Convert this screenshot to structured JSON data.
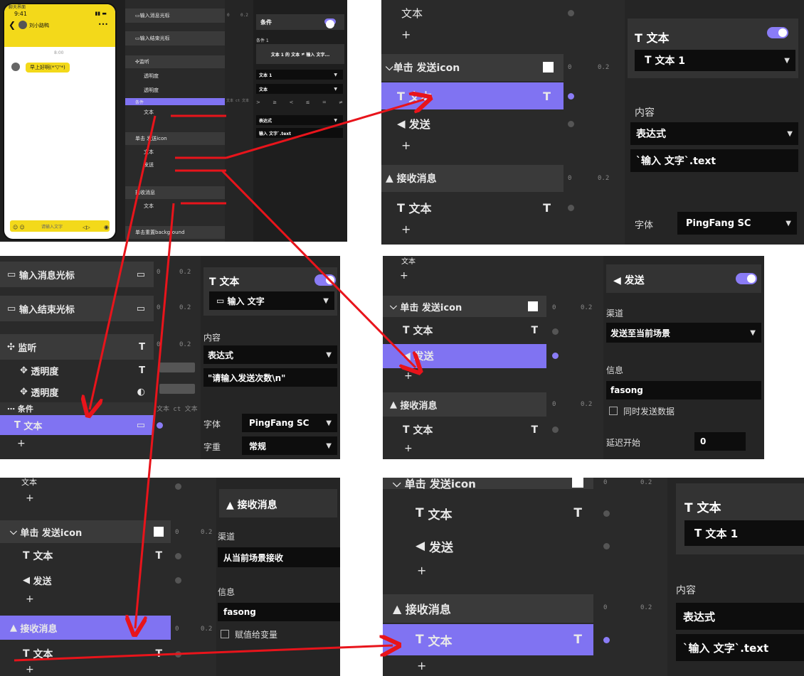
{
  "phone": {
    "window_title": "聊天界面",
    "status_time": "9:41",
    "chat_name": "刘小路鸭",
    "timestamp": "8:00",
    "message": "早上好啊(*'▽'*)",
    "input_placeholder": "请输入文字",
    "more": "•••"
  },
  "panel_overview": {
    "layers": [
      {
        "name": "输入消息光标",
        "badge": "▭"
      },
      {
        "name": "输入结束光标",
        "badge": "▭"
      },
      {
        "name": "监听",
        "badge": "T"
      },
      {
        "name": "透明度",
        "badge": "T"
      },
      {
        "name": "透明度",
        "badge": "◐"
      },
      {
        "name": "条件",
        "badge": ""
      },
      {
        "name": "文本",
        "badge": "▭"
      },
      {
        "name": "单击 发送icon",
        "badge": "■"
      },
      {
        "name": "文本",
        "badge": "T"
      },
      {
        "name": "发送",
        "badge": ""
      },
      {
        "name": "接收消息",
        "badge": ""
      },
      {
        "name": "文本",
        "badge": "T"
      },
      {
        "name": "单击重置background",
        "badge": "▮"
      }
    ],
    "timeline_ticks": [
      "0",
      "0.2"
    ],
    "timeline_note": "文本 ct 文本",
    "inspector": {
      "title": "条件",
      "section": "条件 1",
      "condition_left": "文本 1 的 文本",
      "condition_op": "≠",
      "condition_right": "输入 文字...",
      "target": "文本 1",
      "property": "文本",
      "operators": [
        ">",
        "≥",
        "<",
        "≤",
        "=",
        "≠"
      ],
      "mode": "表达式",
      "expression": "输入 文字`.text"
    }
  },
  "panel_a": {
    "rows": [
      {
        "name": "文本",
        "badge": "▭"
      },
      {
        "name": "单击 发送icon",
        "badge": ""
      },
      {
        "name": "文本",
        "badge": "T"
      },
      {
        "name": "发送",
        "badge": ""
      },
      {
        "name": "接收消息",
        "badge": ""
      },
      {
        "name": "文本",
        "badge": "T"
      }
    ],
    "ticks": [
      "0",
      "0.2"
    ],
    "inspector": {
      "title": "文本",
      "target": "文本 1",
      "content_label": "内容",
      "mode": "表达式",
      "value": "`输入 文字`.text",
      "font_label": "字体",
      "font_value": "PingFang SC"
    }
  },
  "panel_b": {
    "rows": [
      {
        "name": "输入消息光标",
        "badge": "▭"
      },
      {
        "name": "输入结束光标",
        "badge": "▭"
      },
      {
        "name": "监听",
        "badge": "T"
      },
      {
        "name": "透明度",
        "badge": "T"
      },
      {
        "name": "透明度",
        "badge": "◐"
      },
      {
        "name": "条件",
        "badge": ""
      },
      {
        "name": "文本",
        "badge": "▭"
      }
    ],
    "ticks": [
      "0",
      "0.2"
    ],
    "timeline_note": "文本 ct 文本",
    "inspector": {
      "title": "文本",
      "target": "输入 文字",
      "content_label": "内容",
      "mode": "表达式",
      "value": "\"请输入发送次数\\n\"",
      "font_label": "字体",
      "font_value": "PingFang SC",
      "weight_label": "字重",
      "weight_value": "常规"
    }
  },
  "panel_c": {
    "rows": [
      {
        "name": "文本",
        "badge": "T"
      },
      {
        "name": "单击 发送icon",
        "badge": ""
      },
      {
        "name": "文本",
        "badge": "T"
      },
      {
        "name": "发送",
        "badge": ""
      },
      {
        "name": "接收消息",
        "badge": ""
      },
      {
        "name": "文本",
        "badge": "T"
      }
    ],
    "ticks": [
      "0",
      "0.2"
    ],
    "inspector": {
      "title": "发送",
      "channel_label": "渠道",
      "channel_value": "发送至当前场景",
      "info_label": "信息",
      "info_value": "fasong",
      "check_label": "同时发送数据",
      "delay_label": "延迟开始",
      "delay_value": "0"
    }
  },
  "panel_d": {
    "rows": [
      {
        "name": "文本",
        "badge": "▭"
      },
      {
        "name": "单击 发送icon",
        "badge": ""
      },
      {
        "name": "文本",
        "badge": "T"
      },
      {
        "name": "发送",
        "badge": ""
      },
      {
        "name": "接收消息",
        "badge": ""
      },
      {
        "name": "文本",
        "badge": "T"
      }
    ],
    "ticks": [
      "0",
      "0.2"
    ],
    "inspector": {
      "title": "接收消息",
      "channel_label": "渠道",
      "channel_value": "从当前场景接收",
      "info_label": "信息",
      "info_value": "fasong",
      "check_label": "赋值给变量"
    }
  },
  "panel_e": {
    "rows": [
      {
        "name": "单击 发送icon",
        "badge": ""
      },
      {
        "name": "文本",
        "badge": "T"
      },
      {
        "name": "发送",
        "badge": ""
      },
      {
        "name": "接收消息",
        "badge": ""
      },
      {
        "name": "文本",
        "badge": "T"
      }
    ],
    "ticks": [
      "0",
      "0.2"
    ],
    "inspector": {
      "title": "文本",
      "target": "文本 1",
      "content_label": "内容",
      "mode": "表达式",
      "value": "`输入 文字`.text"
    }
  },
  "colors": {
    "accent": "#8073f2",
    "arrow": "#e8141b",
    "panel": "#2a2a2a",
    "field": "#0d0d0d"
  }
}
